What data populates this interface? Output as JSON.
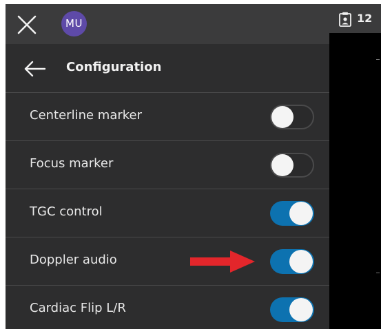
{
  "topbar": {
    "close_icon": "close-icon",
    "avatar_initials": "MU"
  },
  "header": {
    "back_icon": "back-arrow-icon",
    "title": "Configuration"
  },
  "settings": [
    {
      "label": "Centerline marker",
      "enabled": false
    },
    {
      "label": "Focus marker",
      "enabled": false
    },
    {
      "label": "TGC control",
      "enabled": true
    },
    {
      "label": "Doppler audio",
      "enabled": true
    },
    {
      "label": "Cardiac Flip L/R",
      "enabled": true
    }
  ],
  "right_tab": {
    "icon": "clipboard-user-icon",
    "count": "12"
  },
  "annotation": {
    "icon": "red-arrow-icon",
    "points_to": "Doppler audio",
    "color": "#e3262b"
  },
  "colors": {
    "toggle_on": "#0d72b0",
    "panel_bg": "#2d2d2e",
    "topbar_bg": "#3b3b3c"
  }
}
